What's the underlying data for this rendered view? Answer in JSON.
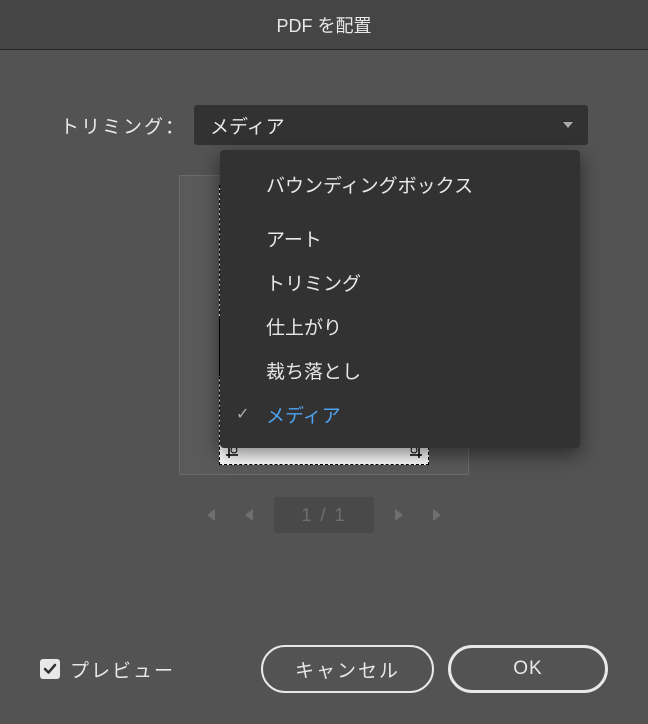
{
  "dialog": {
    "title": "PDF を配置"
  },
  "trim": {
    "label": "トリミング：",
    "selected": "メディア",
    "options": [
      "バウンディングボックス",
      "アート",
      "トリミング",
      "仕上がり",
      "裁ち落とし",
      "メディア"
    ]
  },
  "pager": {
    "counter": "1 / 1"
  },
  "footer": {
    "preview_label": "プレビュー",
    "preview_checked": true,
    "cancel": "キャンセル",
    "ok": "OK"
  }
}
